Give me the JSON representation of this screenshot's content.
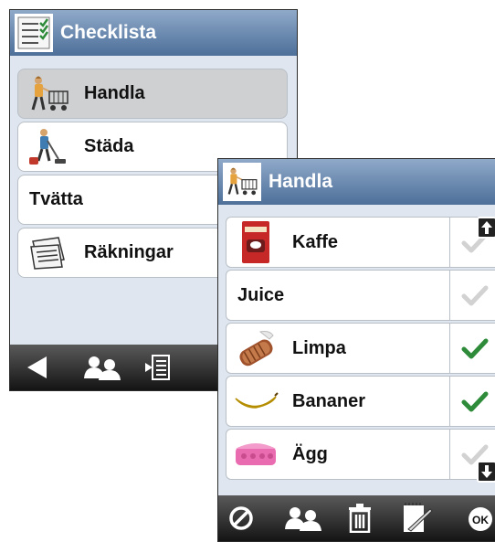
{
  "back_window": {
    "title": "Checklista",
    "title_icon": "checklist-icon",
    "items": [
      {
        "label": "Handla",
        "icon": "shopping-cart-person-icon",
        "selected": true
      },
      {
        "label": "Städa",
        "icon": "vacuum-person-icon",
        "selected": false
      },
      {
        "label": "Tvätta",
        "icon": "",
        "selected": false
      },
      {
        "label": "Räkningar",
        "icon": "bills-icon",
        "selected": false
      }
    ],
    "toolbar": [
      "back-arrow-icon",
      "users-icon",
      "list-edit-icon"
    ]
  },
  "front_window": {
    "title": "Handla",
    "title_icon": "shopping-cart-person-icon",
    "items": [
      {
        "label": "Kaffe",
        "icon": "coffee-package-icon",
        "checked": false
      },
      {
        "label": "Juice",
        "icon": "",
        "checked": false
      },
      {
        "label": "Limpa",
        "icon": "bread-icon",
        "checked": true
      },
      {
        "label": "Bananer",
        "icon": "banana-icon",
        "checked": true
      },
      {
        "label": "Ägg",
        "icon": "egg-carton-icon",
        "checked": false
      }
    ],
    "toolbar": [
      "cancel-icon",
      "users-icon",
      "trash-icon",
      "edit-note-icon",
      "ok-icon"
    ]
  },
  "colors": {
    "titlebar_top": "#8fa9c9",
    "titlebar_bottom": "#4d6f99",
    "window_bg": "#dfe6ef",
    "check_green": "#2e8b3a",
    "check_gray": "#d2d2d2"
  }
}
